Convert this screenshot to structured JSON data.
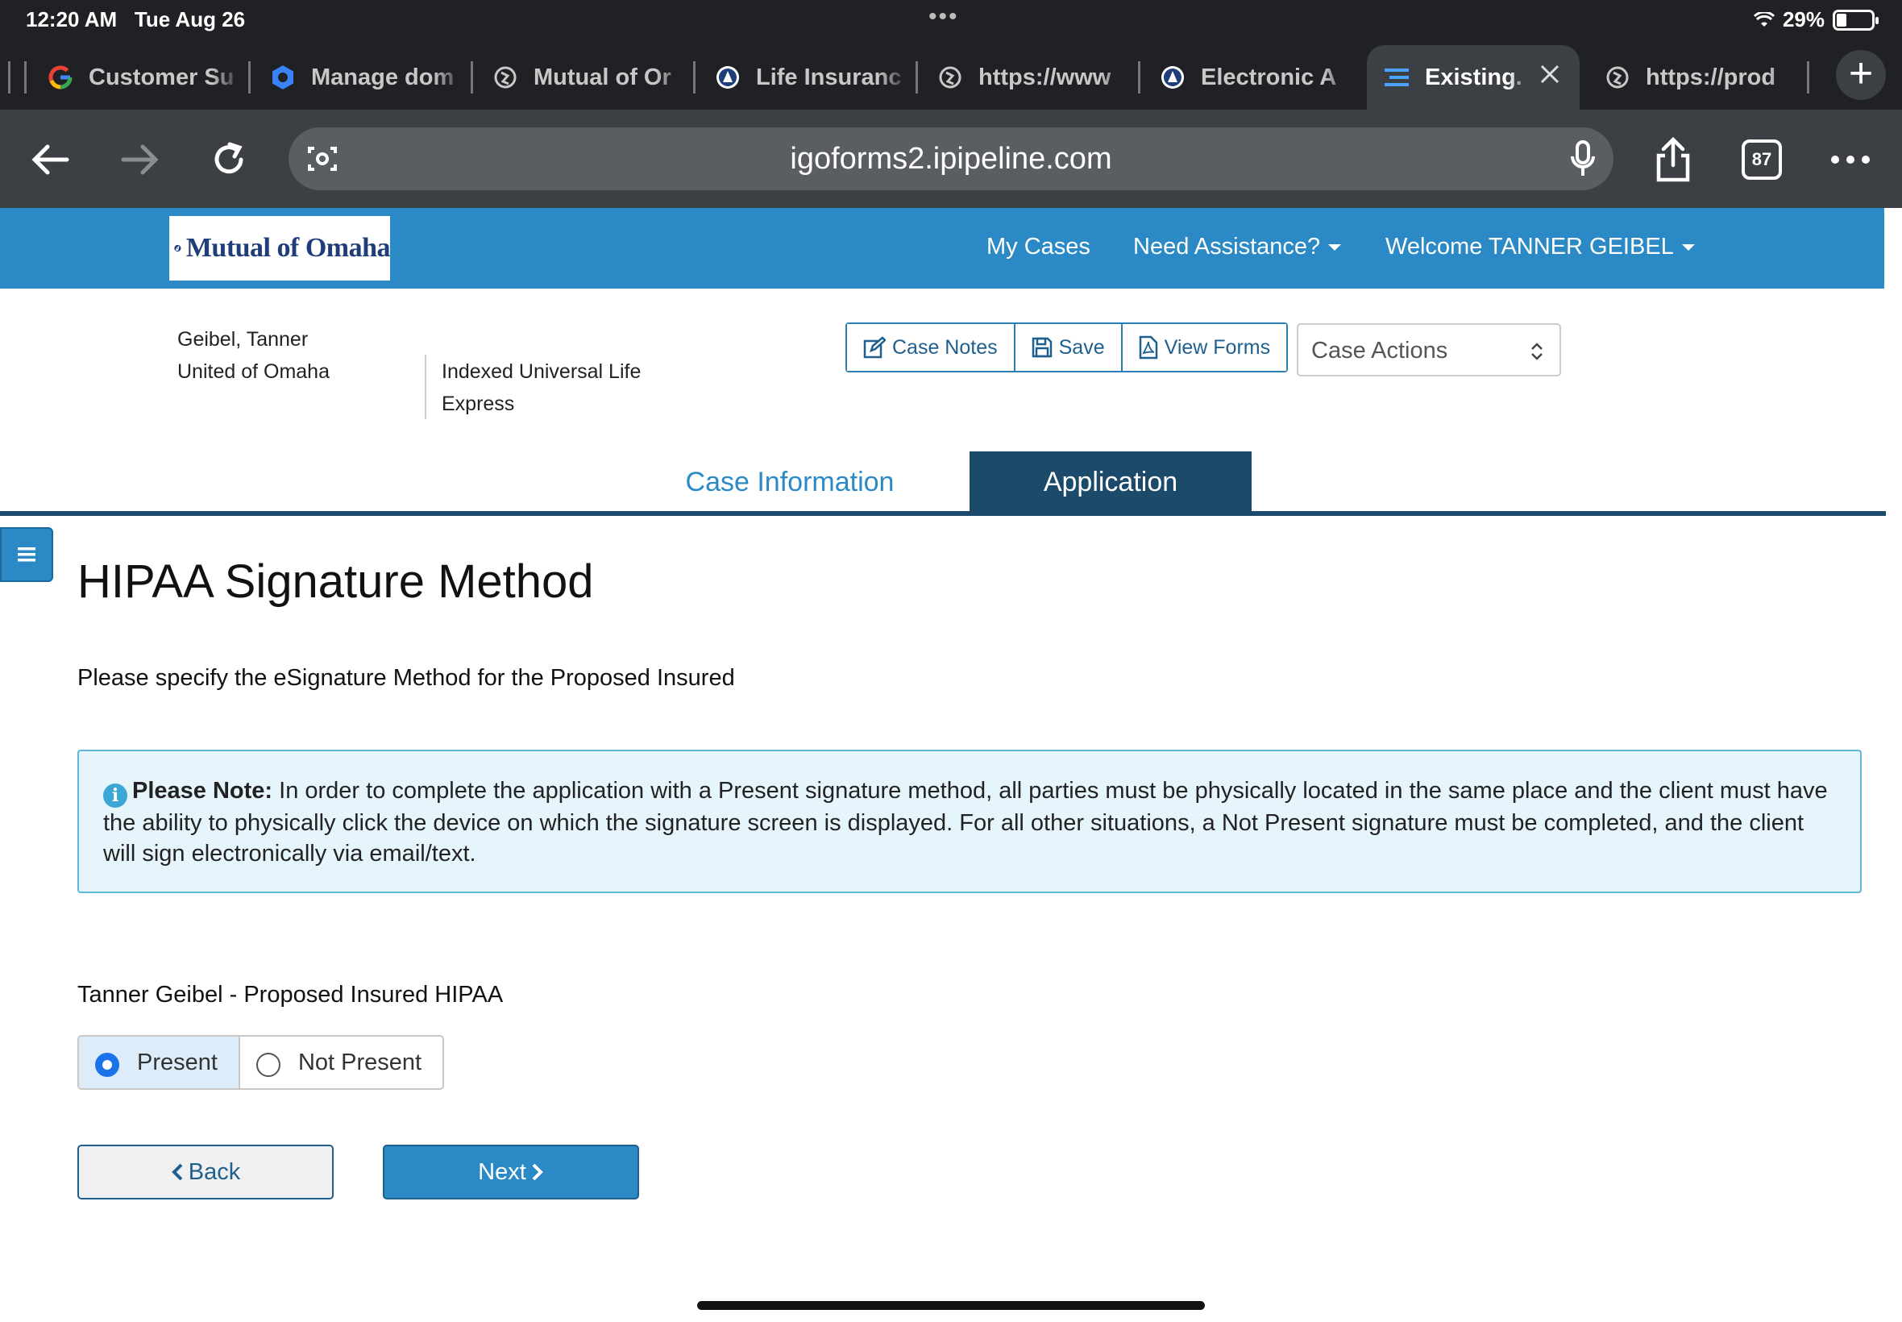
{
  "status_bar": {
    "time": "12:20 AM",
    "date": "Tue Aug 26",
    "battery": "29%"
  },
  "browser": {
    "tabs": [
      {
        "title": "Customer Su",
        "icon": "google-icon"
      },
      {
        "title": "Manage dom",
        "icon": "gear-blue-icon"
      },
      {
        "title": "Mutual of Or",
        "icon": "globe-icon"
      },
      {
        "title": "Life Insuranc",
        "icon": "mutual-of-omaha-icon"
      },
      {
        "title": "https://www",
        "icon": "globe-icon"
      },
      {
        "title": "Electronic A",
        "icon": "mutual-of-omaha-icon"
      },
      {
        "title": "Existing.",
        "icon": "list-icon",
        "active": true
      },
      {
        "title": "https://prod",
        "icon": "globe-icon"
      }
    ],
    "url": "igoforms2.ipipeline.com",
    "tab_count": "87"
  },
  "site": {
    "logo_text": "Mutual of Omaha",
    "nav": {
      "my_cases": "My Cases",
      "assistance": "Need Assistance?",
      "welcome": "Welcome",
      "user_name": "TANNER GEIBEL"
    }
  },
  "case": {
    "client_name": "Geibel, Tanner",
    "company": "United of Omaha",
    "product_line1": "Indexed Universal Life",
    "product_line2": "Express",
    "buttons": {
      "case_notes": "Case Notes",
      "save": "Save",
      "view_forms": "View Forms"
    },
    "case_actions": "Case Actions"
  },
  "tabs": {
    "case_information": "Case Information",
    "application": "Application"
  },
  "page": {
    "title": "HIPAA Signature Method",
    "subtitle": "Please specify the eSignature Method for the Proposed Insured",
    "note_label": "Please Note:",
    "note_text": "In order to complete the application with a Present signature method, all parties must be physically located in the same place and the client must have the ability to physically click the device on which the signature screen is displayed. For all other situations, a Not Present signature must be completed, and the client will sign electronically via email/text.",
    "question": "Tanner Geibel - Proposed Insured HIPAA",
    "options": {
      "present": "Present",
      "not_present": "Not Present",
      "selected": "Present"
    },
    "back": "Back",
    "next": "Next"
  },
  "colors": {
    "header_blue": "#2b8ac6",
    "tab_active": "#1b4a6b",
    "note_bg": "#e6f5fb"
  }
}
